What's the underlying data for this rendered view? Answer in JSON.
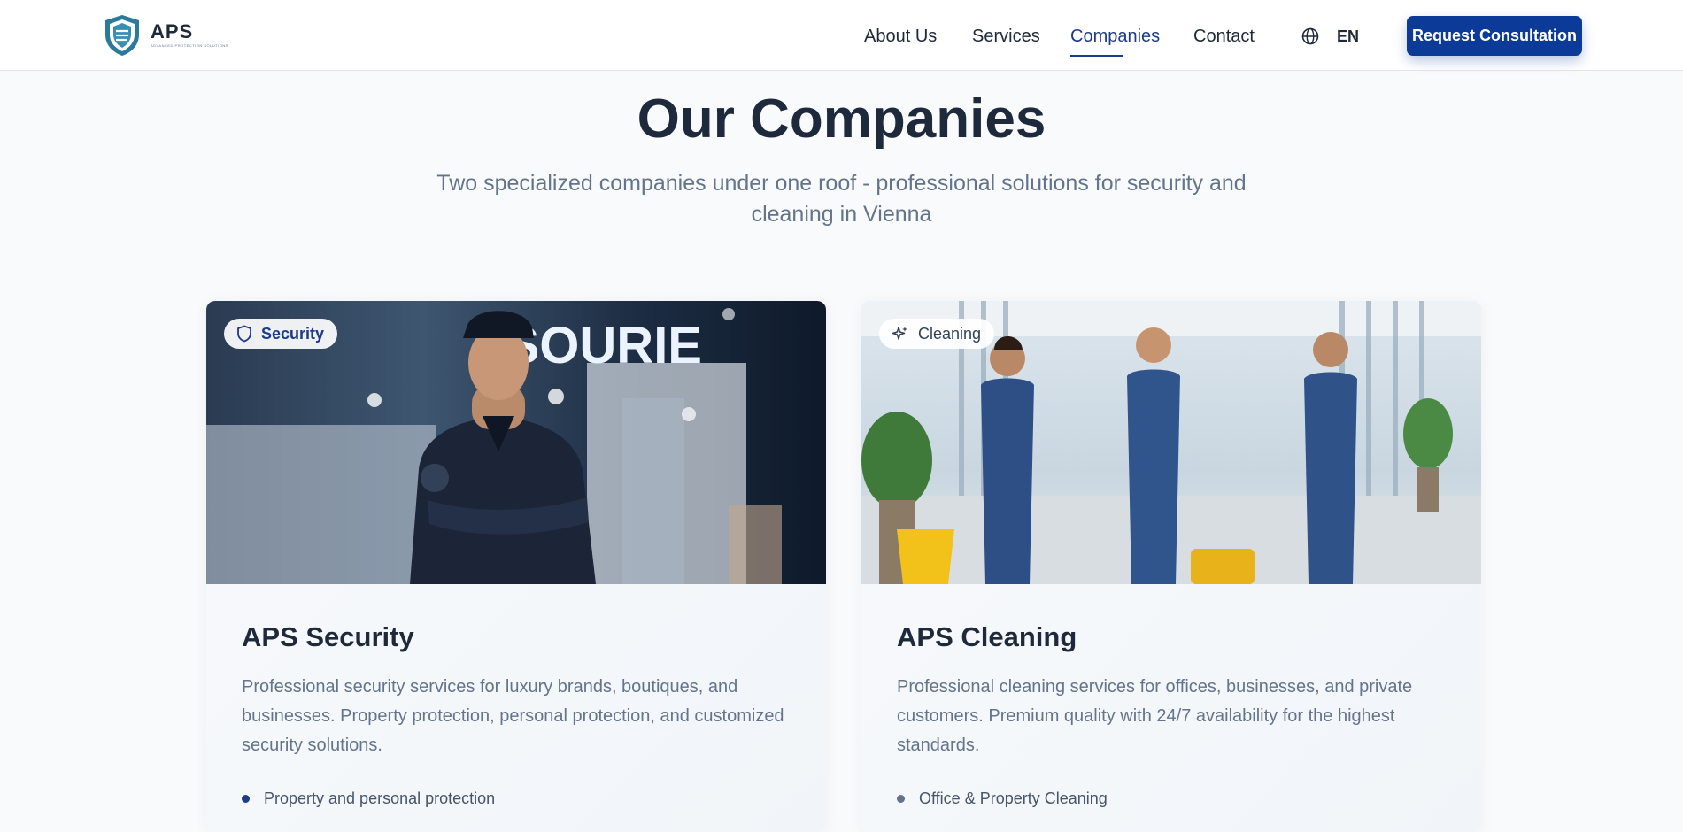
{
  "header": {
    "logo_title": "APS",
    "logo_subtitle": "ADVANCED PROTECTION SOLUTIONS",
    "nav": [
      {
        "label": "About Us"
      },
      {
        "label": "Services"
      },
      {
        "label": "Companies",
        "active": true
      },
      {
        "label": "Contact"
      }
    ],
    "language": {
      "icon": "globe-icon",
      "label": "EN"
    },
    "cta_label": "Request Consultation"
  },
  "section": {
    "title": "Our Companies",
    "subtitle": "Two specialized companies under one roof - professional solutions for security and cleaning in Vienna"
  },
  "cards": [
    {
      "badge": "Security",
      "badge_icon": "shield-icon",
      "image_sign_text": "SOURIE",
      "title": "APS Security",
      "description": "Professional security services for luxury brands, boutiques, and businesses. Property protection, personal protection, and customized security solutions.",
      "features": [
        "Property and personal protection"
      ]
    },
    {
      "badge": "Cleaning",
      "badge_icon": "sparkles-icon",
      "title": "APS Cleaning",
      "description": "Professional cleaning services for offices, businesses, and private customers. Premium quality with 24/7 availability for the highest standards.",
      "features": [
        "Office & Property Cleaning"
      ]
    }
  ],
  "colors": {
    "brand": "#0c3a99",
    "nav_active": "#1e3a8a",
    "heading": "#1e293b",
    "muted": "#64748b",
    "page_bg": "#f8fafc"
  }
}
